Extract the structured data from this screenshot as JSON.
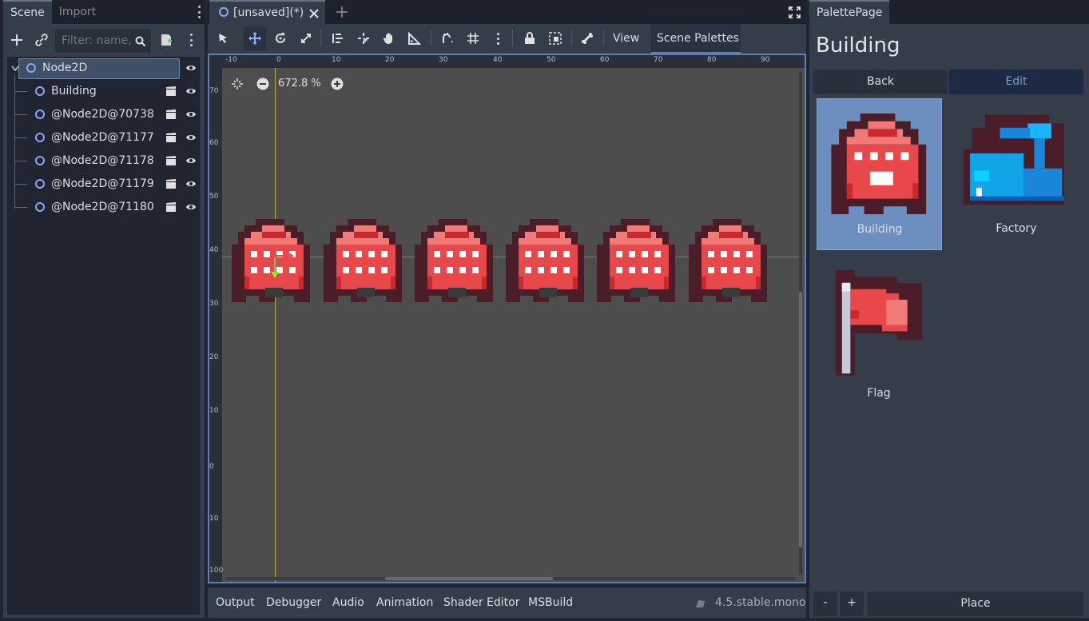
{
  "scene_dock": {
    "tabs": [
      "Scene",
      "Import"
    ],
    "filter_placeholder": "Filter: name, t",
    "nodes": [
      {
        "name": "Node2D",
        "selected": true
      },
      {
        "name": "Building"
      },
      {
        "name": "@Node2D@70738"
      },
      {
        "name": "@Node2D@71177"
      },
      {
        "name": "@Node2D@71178"
      },
      {
        "name": "@Node2D@71179"
      },
      {
        "name": "@Node2D@71180"
      }
    ]
  },
  "editor": {
    "tab_title": "[unsaved](*)",
    "toolbar": {
      "view_label": "View",
      "scene_palettes_label": "Scene Palettes"
    },
    "zoom_text": "672.8 %",
    "ruler_h": [
      "-10",
      "0",
      "10",
      "20",
      "30",
      "40",
      "50",
      "60",
      "70",
      "80",
      "90"
    ],
    "ruler_v": [
      "70",
      "60",
      "50",
      "40",
      "30",
      "20",
      "10",
      "0",
      "10",
      "100"
    ],
    "instances_count": 6
  },
  "bottom_panel": {
    "tabs": [
      "Output",
      "Debugger",
      "Audio",
      "Animation",
      "Shader Editor",
      "MSBuild"
    ],
    "version": "4.5.stable.mono"
  },
  "palette_dock": {
    "tab": "PalettePage",
    "title": "Building",
    "back_label": "Back",
    "edit_label": "Edit",
    "items": [
      {
        "label": "Building",
        "selected": true
      },
      {
        "label": "Factory"
      },
      {
        "label": "Flag"
      }
    ],
    "minus_label": "-",
    "plus_label": "+",
    "place_label": "Place"
  },
  "colors": {
    "accent": "#5c80b3",
    "selection": "#6c8fbf",
    "edit_button": "#1d2a43",
    "building_red": "#e8484a",
    "factory_blue": "#11a5e8"
  }
}
